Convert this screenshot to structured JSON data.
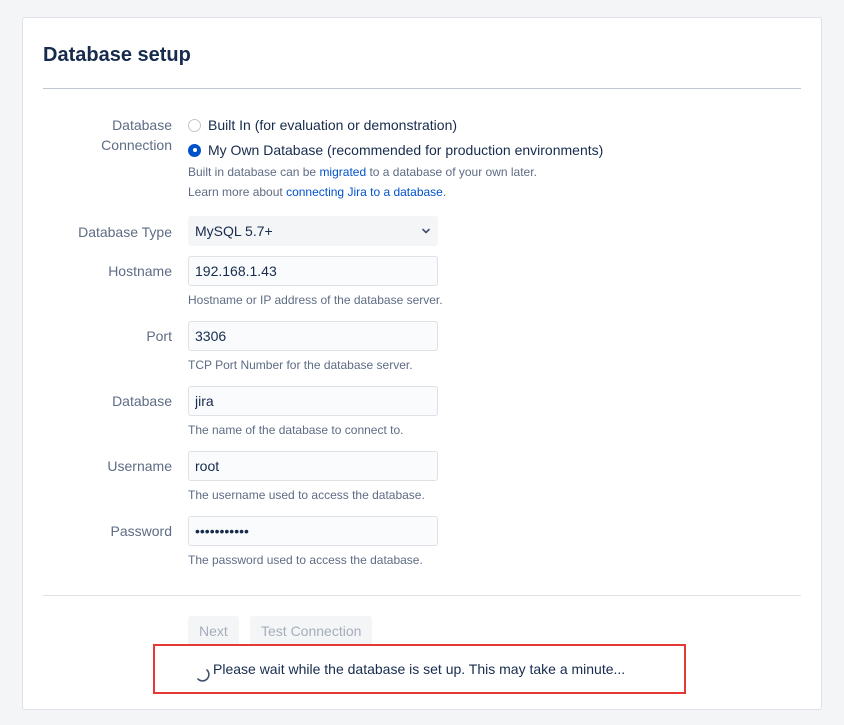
{
  "page": {
    "title": "Database setup"
  },
  "connection": {
    "label_line1": "Database",
    "label_line2": "Connection",
    "options": [
      {
        "label": "Built In (for evaluation or demonstration)",
        "checked": false
      },
      {
        "label": "My Own Database (recommended for production environments)",
        "checked": true
      }
    ],
    "help1_prefix": "Built in database can be ",
    "help1_link": "migrated",
    "help1_suffix": " to a database of your own later.",
    "help2_prefix": "Learn more about ",
    "help2_link": "connecting Jira to a database",
    "help2_suffix": "."
  },
  "fields": {
    "db_type": {
      "label": "Database Type",
      "value": "MySQL 5.7+"
    },
    "hostname": {
      "label": "Hostname",
      "value": "192.168.1.43",
      "help": "Hostname or IP address of the database server."
    },
    "port": {
      "label": "Port",
      "value": "3306",
      "help": "TCP Port Number for the database server."
    },
    "database": {
      "label": "Database",
      "value": "jira",
      "help": "The name of the database to connect to."
    },
    "username": {
      "label": "Username",
      "value": "root",
      "help": "The username used to access the database."
    },
    "password": {
      "label": "Password",
      "value": "•••••••••••",
      "help": "The password used to access the database."
    }
  },
  "buttons": {
    "next": "Next",
    "test": "Test Connection"
  },
  "status": {
    "message": "Please wait while the database is set up. This may take a minute..."
  },
  "colors": {
    "accent": "#0052cc",
    "highlight_border": "#e53935"
  }
}
